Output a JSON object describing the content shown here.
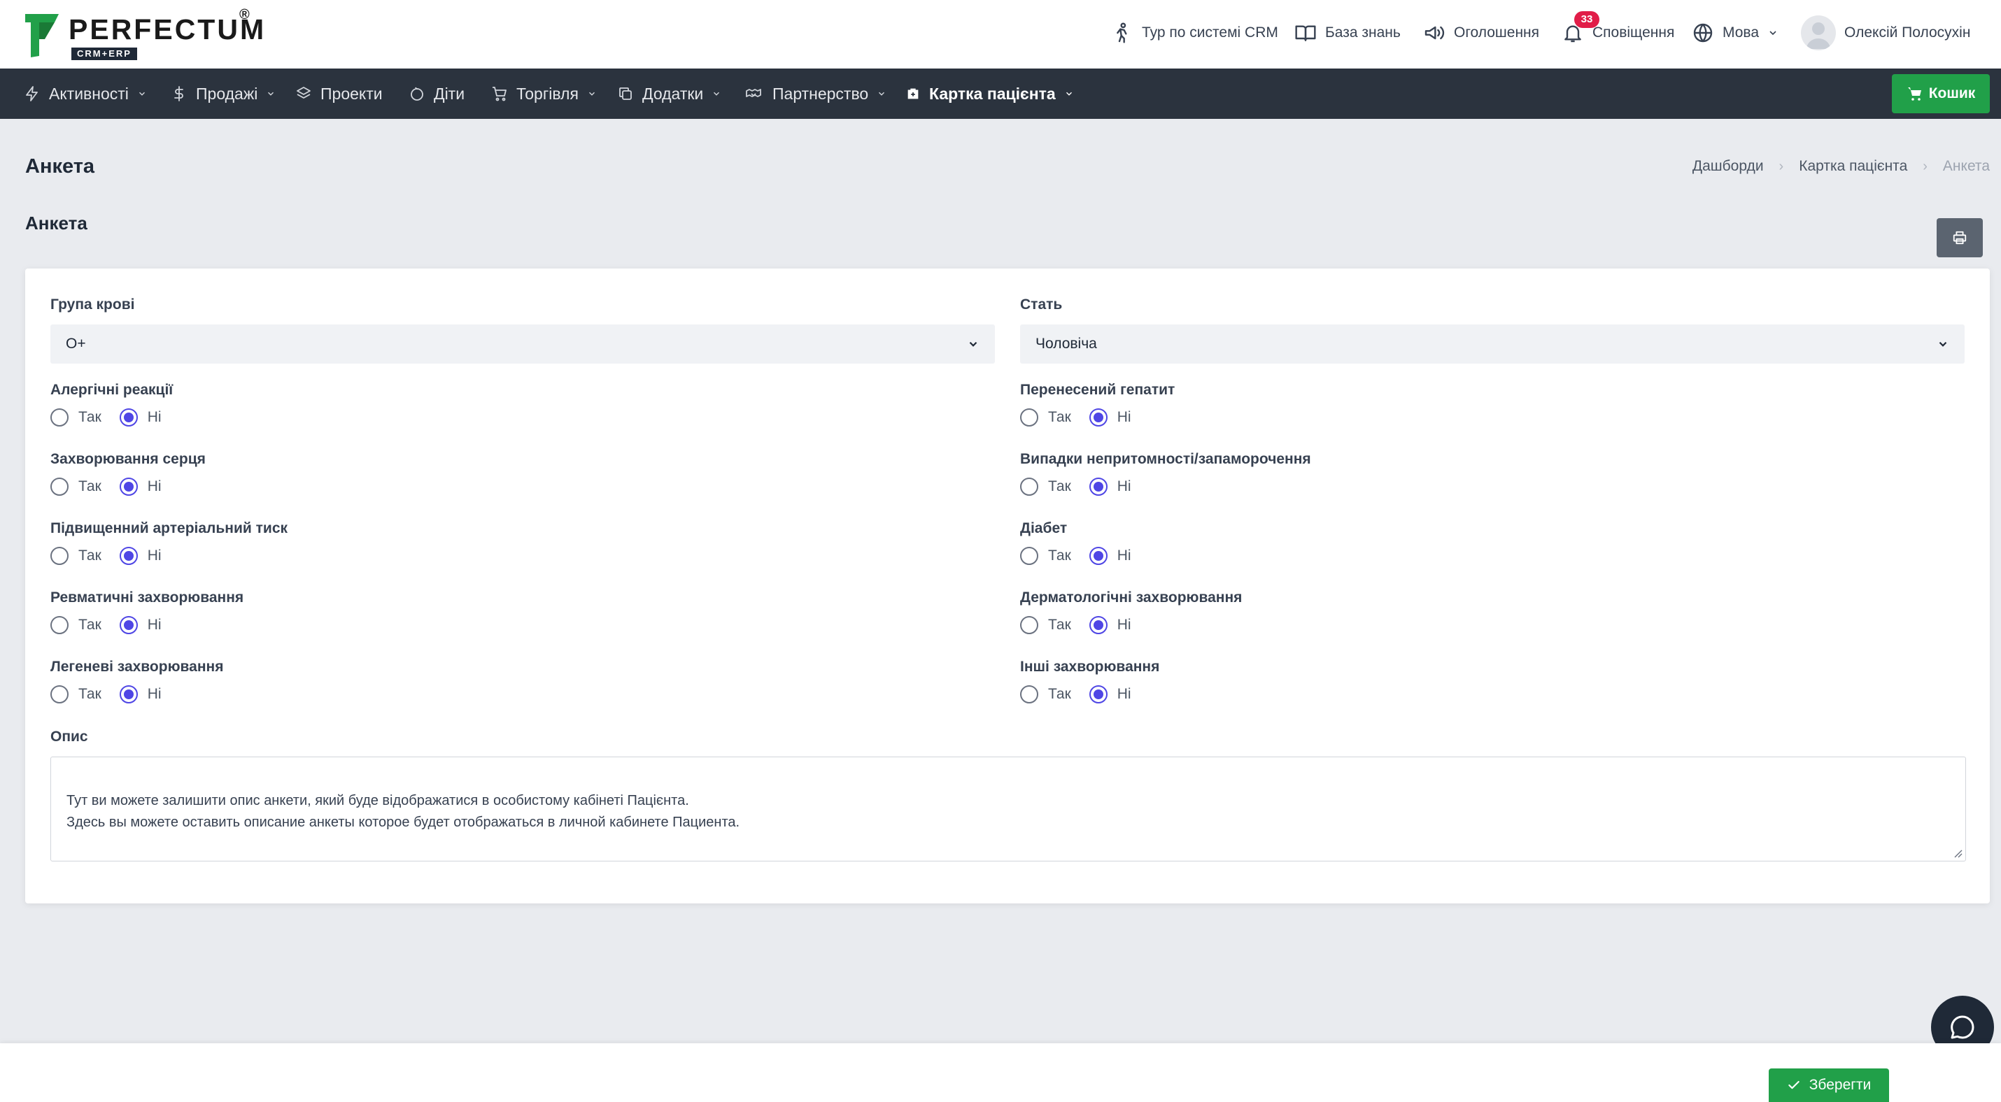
{
  "brand": {
    "name": "PERFECTUM",
    "reg": "®",
    "sub": "CRM+ERP",
    "color": "#21a049"
  },
  "header": {
    "tour": "Тур по системі CRM",
    "knowledge": "База знань",
    "announcements": "Оголошення",
    "notifications": "Сповіщення",
    "notifications_count": "33",
    "language": "Мова",
    "user": "Олексій Полосухін"
  },
  "menu": {
    "activities": "Активності",
    "sales": "Продажі",
    "projects": "Проекти",
    "kids": "Діти",
    "trade": "Торгівля",
    "addons": "Додатки",
    "partnership": "Партнерство",
    "patient_card": "Картка пацієнта",
    "cart": "Кошик"
  },
  "page": {
    "title": "Анкета",
    "section": "Анкета",
    "breadcrumb": [
      "Дашборди",
      "Картка пацієнта",
      "Анкета"
    ]
  },
  "form": {
    "yes": "Так",
    "no": "Ні",
    "blood_group": {
      "label": "Група крові",
      "value": "O+"
    },
    "gender": {
      "label": "Стать",
      "value": "Чоловіча"
    },
    "questions": [
      {
        "label": "Алергічні реакції",
        "value": "no"
      },
      {
        "label": "Перенесений гепатит",
        "value": "no"
      },
      {
        "label": "Захворювання серця",
        "value": "no"
      },
      {
        "label": "Випадки непритомності/запаморочення",
        "value": "no"
      },
      {
        "label": "Підвищенний артеріальний тиск",
        "value": "no"
      },
      {
        "label": "Діабет",
        "value": "no"
      },
      {
        "label": "Ревматичні захворювання",
        "value": "no"
      },
      {
        "label": "Дерматологічні захворювання",
        "value": "no"
      },
      {
        "label": "Легеневі захворювання",
        "value": "no"
      },
      {
        "label": "Інші захворювання",
        "value": "no"
      }
    ],
    "description": {
      "label": "Опис",
      "value": "Тут ви можете залишити опис анкети, який буде відображатися в особистому кабінеті Пацієнта.\nЗдесь вы можете оставить описание анкеты которое будет отображаться в личной кабинете Пациента."
    }
  },
  "footer": {
    "save": "Зберегти"
  },
  "colors": {
    "accent": "#4f46e5",
    "menu_bg": "#2b333e",
    "success": "#21a049"
  }
}
